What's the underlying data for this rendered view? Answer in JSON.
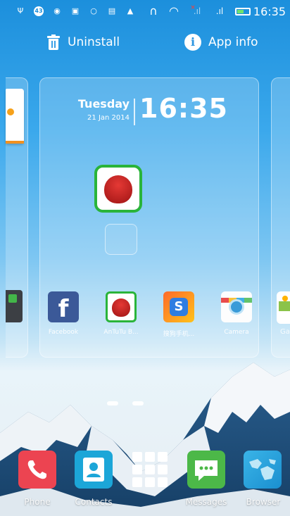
{
  "status_bar": {
    "time": "16:35",
    "notification_badge": "43",
    "icons": [
      "usb-icon",
      "notification-badge-icon",
      "chrome-icon",
      "gallery-icon",
      "record-icon",
      "lock-icon",
      "antutu-notify-icon",
      "headset-icon",
      "wifi-icon",
      "signal-1-icon",
      "signal-2-icon",
      "battery-icon"
    ]
  },
  "action_bar": {
    "uninstall_label": "Uninstall",
    "app_info_label": "App info",
    "info_glyph": "i"
  },
  "clock_widget": {
    "day": "Tuesday",
    "date": "21 Jan 2014",
    "time": "16:35"
  },
  "home_apps": [
    {
      "label": "Facebook",
      "icon": "facebook-icon"
    },
    {
      "label": "AnTuTu B...",
      "icon": "antutu-icon"
    },
    {
      "label": "搜狗手机...",
      "icon": "sogou-icon"
    },
    {
      "label": "Camera",
      "icon": "camera-icon"
    }
  ],
  "right_panel_label": "Ga",
  "dock": [
    {
      "label": "Phone",
      "icon": "phone-icon"
    },
    {
      "label": "Contacts",
      "icon": "contacts-icon"
    },
    {
      "label": "",
      "icon": "app-drawer-icon"
    },
    {
      "label": "Messages",
      "icon": "messages-icon"
    },
    {
      "label": "Browser",
      "icon": "browser-icon"
    }
  ],
  "colors": {
    "facebook": "#3b5998",
    "antutu_border": "#2ab43a",
    "phone": "#ec4451",
    "contacts": "#1ca6d8",
    "messages": "#4cb848"
  }
}
